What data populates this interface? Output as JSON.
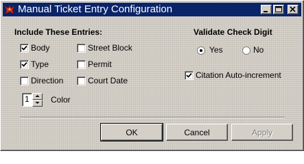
{
  "window": {
    "title": "Manual Ticket Entry Configuration",
    "icon": "red-bird-app-icon",
    "controls": [
      "minimize",
      "maximize",
      "close"
    ]
  },
  "include_section": {
    "heading": "Include These Entries:",
    "checkboxes": [
      {
        "label": "Body",
        "checked": true
      },
      {
        "label": "Type",
        "checked": true
      },
      {
        "label": "Direction",
        "checked": false
      },
      {
        "label": "Street Block",
        "checked": false
      },
      {
        "label": "Permit",
        "checked": false
      },
      {
        "label": "Court Date",
        "checked": false
      }
    ]
  },
  "color_spinner": {
    "value": "1",
    "label": "Color"
  },
  "validate_section": {
    "heading": "Validate Check Digit",
    "options": [
      {
        "label": "Yes",
        "selected": true
      },
      {
        "label": "No",
        "selected": false
      }
    ]
  },
  "citation_auto_increment": {
    "label": "Citation Auto-increment",
    "checked": true
  },
  "buttons": {
    "ok": "OK",
    "cancel": "Cancel",
    "apply": "Apply",
    "apply_enabled": false
  },
  "colors": {
    "titlebar": "#0a246a",
    "face": "#d4d0c8"
  }
}
